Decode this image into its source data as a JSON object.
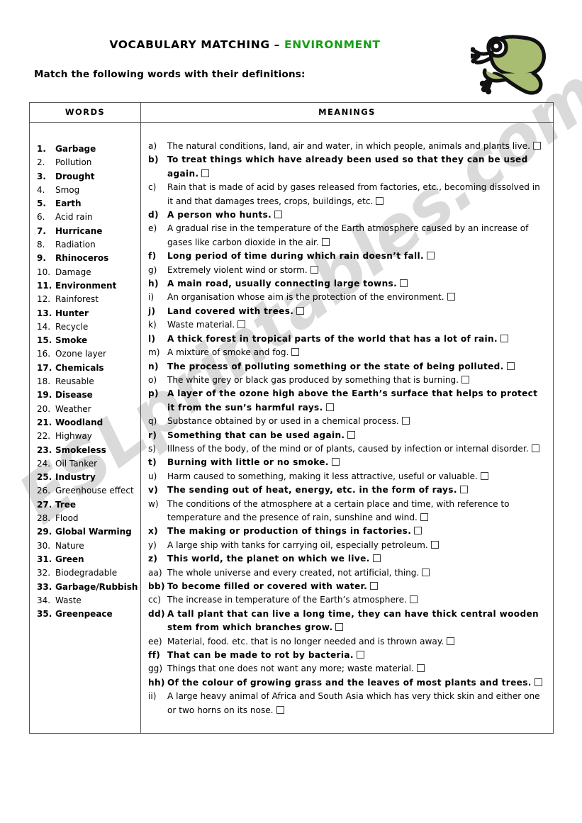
{
  "header": {
    "title_main": "VOCABULARY MATCHING – ",
    "title_accent": "ENVIRONMENT",
    "instruction": "Match the following words with their definitions:",
    "accent_color": "#15a015"
  },
  "watermark": {
    "text": "ESLprintables.com"
  },
  "illustration": {
    "name": "frog",
    "body_color": "#a8bc72",
    "outline_color": "#111111"
  },
  "table": {
    "header_words": "WORDS",
    "header_meanings": "MEANINGS",
    "border_color": "#555555"
  },
  "words": [
    {
      "num": "1.",
      "text": "Garbage",
      "bold": true
    },
    {
      "num": "2.",
      "text": "Pollution",
      "bold": false
    },
    {
      "num": "3.",
      "text": "Drought",
      "bold": true
    },
    {
      "num": "4.",
      "text": "Smog",
      "bold": false
    },
    {
      "num": "5.",
      "text": "Earth",
      "bold": true
    },
    {
      "num": "6.",
      "text": "Acid rain",
      "bold": false
    },
    {
      "num": "7.",
      "text": "Hurricane",
      "bold": true
    },
    {
      "num": "8.",
      "text": "Radiation",
      "bold": false
    },
    {
      "num": "9.",
      "text": "Rhinoceros",
      "bold": true
    },
    {
      "num": "10.",
      "text": "Damage",
      "bold": false
    },
    {
      "num": "11.",
      "text": "Environment",
      "bold": true
    },
    {
      "num": "12.",
      "text": "Rainforest",
      "bold": false
    },
    {
      "num": "13.",
      "text": "Hunter",
      "bold": true
    },
    {
      "num": "14.",
      "text": "Recycle",
      "bold": false
    },
    {
      "num": "15.",
      "text": "Smoke",
      "bold": true
    },
    {
      "num": "16.",
      "text": "Ozone layer",
      "bold": false
    },
    {
      "num": "17.",
      "text": "Chemicals",
      "bold": true
    },
    {
      "num": "18.",
      "text": "Reusable",
      "bold": false
    },
    {
      "num": "19.",
      "text": "Disease",
      "bold": true
    },
    {
      "num": "20.",
      "text": "Weather",
      "bold": false
    },
    {
      "num": "21.",
      "text": "Woodland",
      "bold": true
    },
    {
      "num": "22.",
      "text": "Highway",
      "bold": false
    },
    {
      "num": "23.",
      "text": "Smokeless",
      "bold": true
    },
    {
      "num": "24.",
      "text": "Oil Tanker",
      "bold": false
    },
    {
      "num": "25.",
      "text": "Industry",
      "bold": true
    },
    {
      "num": "26.",
      "text": "Greenhouse effect",
      "bold": false
    },
    {
      "num": "27.",
      "text": "Tree",
      "bold": true
    },
    {
      "num": "28.",
      "text": "Flood",
      "bold": false
    },
    {
      "num": "29.",
      "text": "Global  Warming",
      "bold": true
    },
    {
      "num": "30.",
      "text": "Nature",
      "bold": false
    },
    {
      "num": "31.",
      "text": "Green",
      "bold": true
    },
    {
      "num": "32.",
      "text": "Biodegradable",
      "bold": false
    },
    {
      "num": "33.",
      "text": "Garbage/Rubbish",
      "bold": true
    },
    {
      "num": "34.",
      "text": "Waste",
      "bold": false
    },
    {
      "num": "35.",
      "text": "Greenpeace",
      "bold": true
    }
  ],
  "meanings": [
    {
      "label": "a)",
      "text": "The natural conditions, land, air and water, in which people, animals and plants live.",
      "bold": false
    },
    {
      "label": "b)",
      "text": "To treat things which have already been used so that they can be used again.",
      "bold": true
    },
    {
      "label": "c)",
      "text": "Rain that is made of acid by gases released from factories, etc., becoming dissolved in it and that damages trees, crops, buildings, etc.",
      "bold": false
    },
    {
      "label": "d)",
      "text": " A person who hunts.",
      "bold": true
    },
    {
      "label": "e)",
      "text": "A gradual rise in the temperature of the Earth atmosphere caused by an increase of gases like carbon dioxide in the air.",
      "bold": false
    },
    {
      "label": "f)",
      "text": "Long period of time during which rain doesn’t fall.",
      "bold": true
    },
    {
      "label": "g)",
      "text": "Extremely violent wind or storm.",
      "bold": false
    },
    {
      "label": "h)",
      "text": "A main road, usually connecting large towns.",
      "bold": true
    },
    {
      "label": "i)",
      "text": "An organisation whose aim is the protection of the environment.",
      "bold": false
    },
    {
      "label": "j)",
      "text": "Land covered with trees.",
      "bold": true
    },
    {
      "label": "k)",
      "text": "Waste material.",
      "bold": false
    },
    {
      "label": "l)",
      "text": "A thick forest in tropical parts of the world that has a lot of rain.",
      "bold": true
    },
    {
      "label": "m)",
      "text": "A mixture of smoke and fog.",
      "bold": false
    },
    {
      "label": "n)",
      "text": "The process of polluting something or the state of being polluted.",
      "bold": true
    },
    {
      "label": "o)",
      "text": "The white grey or black gas produced by something that is burning.",
      "bold": false
    },
    {
      "label": "p)",
      "text": "A layer of the ozone high above the Earth’s surface that helps to protect it from the sun’s harmful rays.",
      "bold": true
    },
    {
      "label": "q)",
      "text": "Substance obtained by or used in a chemical process.",
      "bold": false
    },
    {
      "label": "r)",
      "text": "Something that can be used again.",
      "bold": true
    },
    {
      "label": "s)",
      "text": "Illness of the body, of the mind or of plants, caused by infection or internal disorder.",
      "bold": false
    },
    {
      "label": "t)",
      "text": "Burning with little or no smoke.",
      "bold": true
    },
    {
      "label": "u)",
      "text": "Harm caused to something, making it less attractive, useful or valuable.",
      "bold": false
    },
    {
      "label": "v)",
      "text": "The sending out of heat, energy, etc. in the form of rays.",
      "bold": true
    },
    {
      "label": "w)",
      "text": "The conditions of the atmosphere at a certain place and time, with reference to temperature and the presence of rain, sunshine and wind.",
      "bold": false
    },
    {
      "label": "x)",
      "text": "The making or production of things in factories.",
      "bold": true
    },
    {
      "label": "y)",
      "text": "A large ship with tanks for carrying oil, especially petroleum.",
      "bold": false
    },
    {
      "label": "z)",
      "text": "This world, the planet on which we live.",
      "bold": true
    },
    {
      "label": "aa)",
      "text": "The whole universe and every created, not artificial, thing.",
      "bold": false
    },
    {
      "label": "bb)",
      "text": "To become filled or covered with water.",
      "bold": true
    },
    {
      "label": "cc)",
      "text": "The increase in temperature of the Earth’s atmosphere.",
      "bold": false
    },
    {
      "label": "dd)",
      "text": "A tall plant that can live a long time, they can have thick central wooden stem from which branches grow.",
      "bold": true
    },
    {
      "label": "ee)",
      "text": "Material, food. etc. that is no longer needed and is thrown away.",
      "bold": false
    },
    {
      "label": "ff)",
      "text": "That can be made to rot by bacteria.",
      "bold": true
    },
    {
      "label": "gg)",
      "text": "Things that one does not want any more; waste material.",
      "bold": false
    },
    {
      "label": "hh)",
      "text": "Of the colour of growing grass and the leaves of most plants and trees.",
      "bold": true
    },
    {
      "label": "ii)",
      "text": "A large heavy animal of Africa and South Asia which has very thick skin and either one or two horns on its nose.",
      "bold": false
    }
  ]
}
